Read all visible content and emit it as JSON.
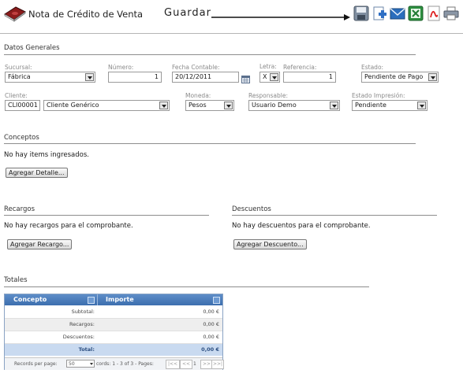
{
  "header": {
    "title": "Nota de Crédito de Venta",
    "guardar_label": "Guardar"
  },
  "datos_generales": {
    "title": "Datos Generales",
    "sucursal": {
      "label": "Sucursal:",
      "value": "Fábrica"
    },
    "numero": {
      "label": "Número:",
      "value": "1"
    },
    "fecha": {
      "label": "Fecha Contable:",
      "value": "20/12/2011"
    },
    "letra": {
      "label": "Letra:",
      "value": "X"
    },
    "referencia": {
      "label": "Referencia:",
      "value": "1"
    },
    "estado": {
      "label": "Estado:",
      "value": "Pendiente de Pago"
    },
    "cliente": {
      "label": "Cliente:",
      "code": "CLI00001",
      "value": "Cliente Genérico"
    },
    "moneda": {
      "label": "Moneda:",
      "value": "Pesos"
    },
    "responsable": {
      "label": "Responsable:",
      "value": "Usuario Demo"
    },
    "estado_impresion": {
      "label": "Estado Impresión:",
      "value": "Pendiente"
    }
  },
  "conceptos": {
    "title": "Conceptos",
    "empty_text": "No hay items ingresados.",
    "add_button": "Agregar Detalle..."
  },
  "recargos": {
    "title": "Recargos",
    "empty_text": "No hay recargos para el comprobante.",
    "add_button": "Agregar Recargo..."
  },
  "descuentos": {
    "title": "Descuentos",
    "empty_text": "No hay descuentos para el comprobante.",
    "add_button": "Agregar Descuento..."
  },
  "totales": {
    "title": "Totales",
    "columns": [
      "Concepto",
      "Importe"
    ],
    "rows": [
      {
        "concepto": "Subtotal:",
        "importe": "0,00 €"
      },
      {
        "concepto": "Recargos:",
        "importe": "0,00 €"
      },
      {
        "concepto": "Descuentos:",
        "importe": "0,00 €"
      },
      {
        "concepto": "Total:",
        "importe": "0,00 €"
      }
    ],
    "pager": {
      "records_label": "Records per page:",
      "records_value": "50",
      "records_info": "cords: 1 - 3 of 3 - Pages:",
      "page": "1",
      "first": "|<<",
      "prev": "<<",
      "next": ">>",
      "last": ">>|"
    }
  },
  "colors": {
    "grid_header": "#4a7cbb",
    "total_row": "#c9daf0",
    "alt_row": "#eeeeee"
  },
  "icons": [
    "book-icon",
    "save-icon",
    "add-document-icon",
    "email-icon",
    "excel-icon",
    "pdf-icon",
    "print-icon"
  ]
}
